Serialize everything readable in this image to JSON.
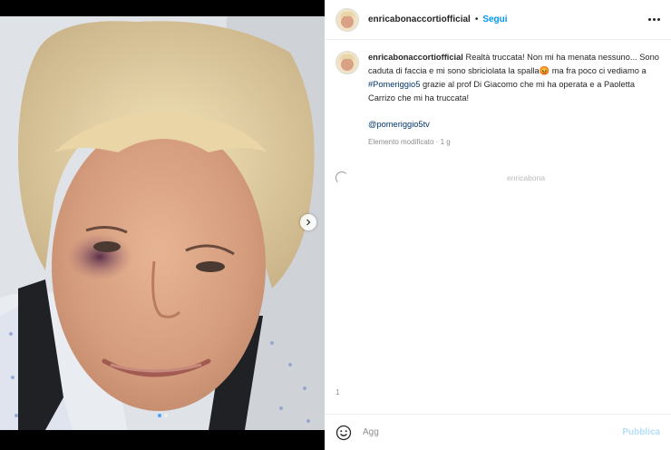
{
  "post": {
    "username": "enricabonaccortiofficial",
    "separator": "•",
    "follow_label": "Segui",
    "caption": {
      "username": "enricabonaccortiofficial",
      "text_before": "Realtà truccata! Non mi ha menata nessuno... Sono caduta di faccia e mi sono sbriciolata la spalla",
      "emoji": "😡",
      "text_middle": " ma fra poco ci vediamo a ",
      "hashtag": "#Pomeriggio5",
      "text_after": " grazie al prof Di Giacomo che mi ha operata e a Paoletta Carrizo che mi ha truccata!",
      "mention": "@pomeriggio5tv"
    },
    "meta": "Elemento modificato · 1 g",
    "loading_ghost_text": "enricabona",
    "partial_text": "1",
    "comment_placeholder": "Agg",
    "publish_label": "Pubblica",
    "carousel": {
      "count": 2,
      "active": 1
    },
    "icons": {
      "more": "more-options-icon",
      "next": "chevron-right-icon",
      "emoji": "smiley-icon",
      "spinner": "loading-spinner-icon"
    },
    "colors": {
      "link": "#0095f6",
      "tag": "#00376b",
      "publish_disabled": "#b2dffc"
    }
  }
}
